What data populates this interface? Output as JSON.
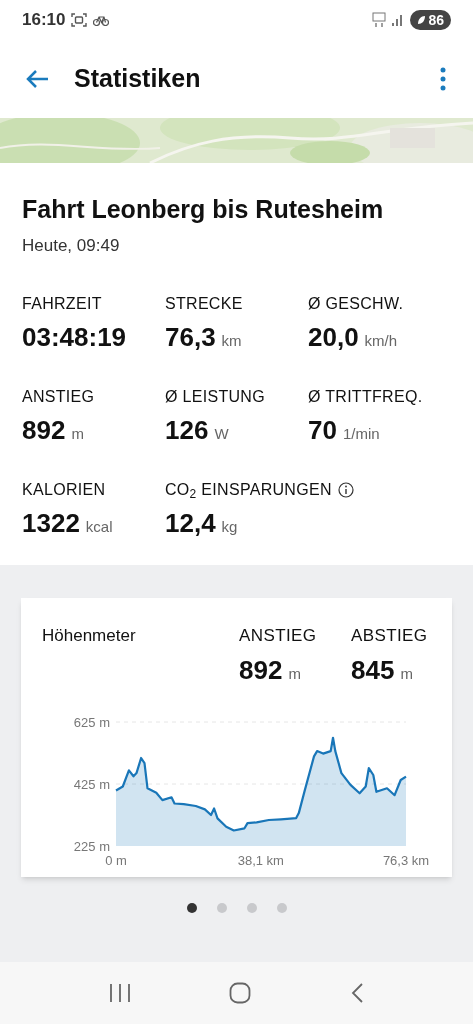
{
  "status_bar": {
    "time": "16:10",
    "battery": "86"
  },
  "app_bar": {
    "title": "Statistiken"
  },
  "ride": {
    "title": "Fahrt Leonberg bis Rutesheim",
    "date": "Heute, 09:49"
  },
  "stats": [
    {
      "label": "FAHRZEIT",
      "value": "03:48:19"
    },
    {
      "label": "STRECKE",
      "value": "76,3",
      "unit": "km"
    },
    {
      "label": "Ø GESCHW.",
      "value": "20,0",
      "unit": "km/h"
    },
    {
      "label": "ANSTIEG",
      "value": "892",
      "unit": "m"
    },
    {
      "label": "Ø LEISTUNG",
      "value": "126",
      "unit": "W"
    },
    {
      "label": "Ø TRITTFREQ.",
      "value": "70",
      "unit": "1/min"
    },
    {
      "label": "KALORIEN",
      "value": "1322",
      "unit": "kcal"
    },
    {
      "label": "CO$_{2}$ EINSPARUNGEN",
      "value": "12,4",
      "unit": "kg",
      "info": true
    }
  ],
  "elevation_card": {
    "title": "Höhenmeter",
    "totals": [
      {
        "label": "ANSTIEG",
        "value": "892",
        "unit": "m"
      },
      {
        "label": "ABSTIEG",
        "value": "845",
        "unit": "m"
      }
    ],
    "chart_data": {
      "type": "area",
      "x": [
        0,
        1.8,
        3.4,
        4.6,
        5.4,
        6.6,
        7.5,
        8.3,
        10.6,
        12.2,
        14.6,
        15.4,
        17.8,
        21,
        23.4,
        25,
        25.8,
        26.7,
        29,
        31,
        33.8,
        34.6,
        37,
        40.2,
        43.4,
        47.4,
        48.1,
        49.7,
        52.1,
        52.9,
        54.5,
        56.5,
        57.1,
        57.7,
        59.3,
        61.7,
        64.1,
        65.7,
        66.5,
        67.7,
        68.5,
        71.3,
        73.3,
        74.9,
        76.3
      ],
      "series": [
        {
          "color": "#1976b8",
          "values": [
            404,
            417,
            469,
            450,
            460,
            509,
            492,
            411,
            397,
            373,
            382,
            362,
            360,
            354,
            343,
            325,
            346,
            314,
            287,
            275,
            282,
            299,
            301,
            309,
            311,
            315,
            331,
            406,
            514,
            531,
            523,
            531,
            574,
            531,
            460,
            422,
            395,
            417,
            476,
            454,
            400,
            411,
            389,
            438,
            449
          ]
        }
      ],
      "xlim": [
        0,
        76.3
      ],
      "ylim": [
        225,
        625
      ],
      "xticks": [
        {
          "value": 0,
          "label": "0 m"
        },
        {
          "value": 38.1,
          "label": "38,1 km"
        },
        {
          "value": 76.3,
          "label": "76,3 km"
        }
      ],
      "yticks": [
        {
          "value": 225,
          "label": "225 m"
        },
        {
          "value": 425,
          "label": "425 m"
        },
        {
          "value": 625,
          "label": "625 m"
        }
      ]
    }
  },
  "pager": [
    {
      "selected": true
    },
    {
      "selected": false
    },
    {
      "selected": false
    },
    {
      "selected": false
    }
  ]
}
